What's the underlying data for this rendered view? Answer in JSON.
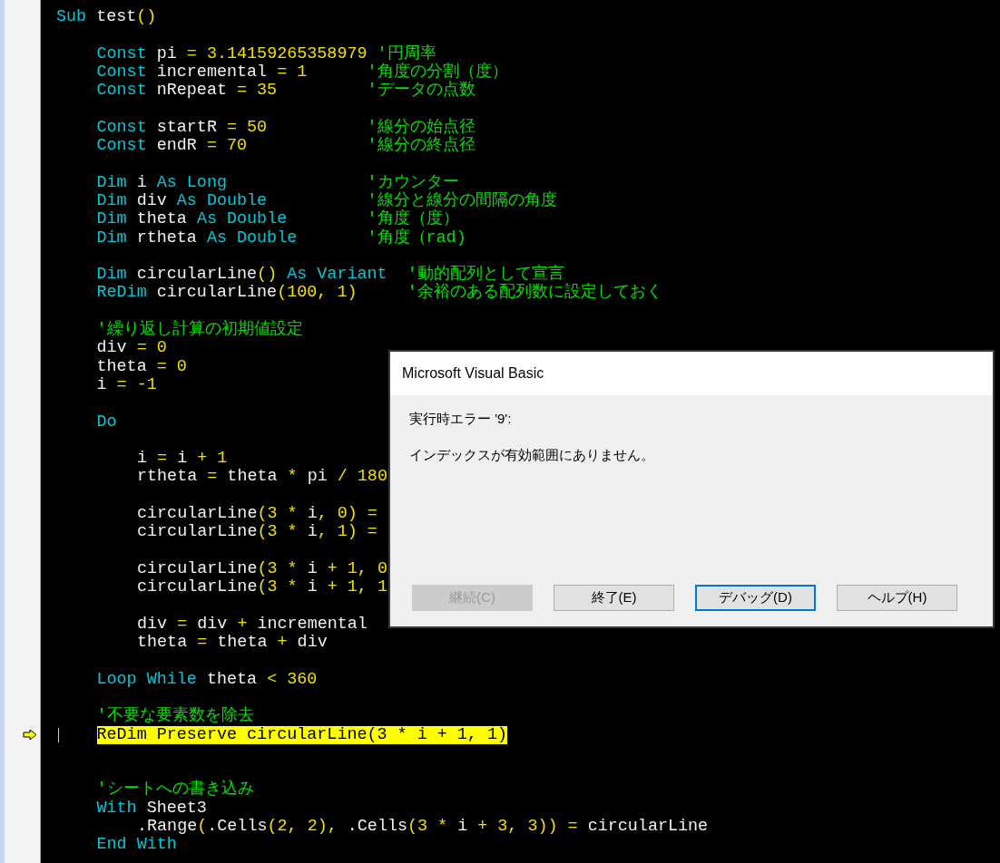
{
  "code": [
    {
      "blank_after": true,
      "tokens": [
        {
          "kind": "keyword",
          "text": "Sub"
        },
        {
          "kind": "identifier",
          "text": " test"
        },
        {
          "kind": "operator",
          "text": "()"
        }
      ],
      "children": [
        {
          "tokens": [
            {
              "kind": "keyword",
              "text": "Const"
            },
            {
              "kind": "identifier",
              "text": " pi "
            },
            {
              "kind": "operator",
              "text": "= 3.14159265358979 "
            },
            {
              "kind": "comment",
              "text": "'円周率"
            }
          ]
        },
        {
          "tokens": [
            {
              "kind": "keyword",
              "text": "Const"
            },
            {
              "kind": "identifier",
              "text": " incremental "
            },
            {
              "kind": "operator",
              "text": "= 1      "
            },
            {
              "kind": "comment",
              "text": "'角度の分割（度）"
            }
          ]
        },
        {
          "blank_after": true,
          "tokens": [
            {
              "kind": "keyword",
              "text": "Const"
            },
            {
              "kind": "identifier",
              "text": " nRepeat "
            },
            {
              "kind": "operator",
              "text": "= 35         "
            },
            {
              "kind": "comment",
              "text": "'データの点数"
            }
          ]
        },
        {
          "tokens": [
            {
              "kind": "keyword",
              "text": "Const"
            },
            {
              "kind": "identifier",
              "text": " startR "
            },
            {
              "kind": "operator",
              "text": "= 50          "
            },
            {
              "kind": "comment",
              "text": "'線分の始点径"
            }
          ]
        },
        {
          "blank_after": true,
          "tokens": [
            {
              "kind": "keyword",
              "text": "Const"
            },
            {
              "kind": "identifier",
              "text": " endR "
            },
            {
              "kind": "operator",
              "text": "= 70            "
            },
            {
              "kind": "comment",
              "text": "'線分の終点径"
            }
          ]
        },
        {
          "tokens": [
            {
              "kind": "keyword",
              "text": "Dim"
            },
            {
              "kind": "identifier",
              "text": " i "
            },
            {
              "kind": "keyword",
              "text": "As Long              "
            },
            {
              "kind": "comment",
              "text": "'カウンター"
            }
          ]
        },
        {
          "tokens": [
            {
              "kind": "keyword",
              "text": "Dim"
            },
            {
              "kind": "identifier",
              "text": " div "
            },
            {
              "kind": "keyword",
              "text": "As Double          "
            },
            {
              "kind": "comment",
              "text": "'線分と線分の間隔の角度"
            }
          ]
        },
        {
          "tokens": [
            {
              "kind": "keyword",
              "text": "Dim"
            },
            {
              "kind": "identifier",
              "text": " theta "
            },
            {
              "kind": "keyword",
              "text": "As Double        "
            },
            {
              "kind": "comment",
              "text": "'角度（度）"
            }
          ]
        },
        {
          "blank_after": true,
          "tokens": [
            {
              "kind": "keyword",
              "text": "Dim"
            },
            {
              "kind": "identifier",
              "text": " rtheta "
            },
            {
              "kind": "keyword",
              "text": "As Double       "
            },
            {
              "kind": "comment",
              "text": "'角度（rad)"
            }
          ]
        },
        {
          "tokens": [
            {
              "kind": "keyword",
              "text": "Dim"
            },
            {
              "kind": "identifier",
              "text": " circularLine"
            },
            {
              "kind": "operator",
              "text": "() "
            },
            {
              "kind": "keyword",
              "text": "As Variant  "
            },
            {
              "kind": "comment",
              "text": "'動的配列として宣言"
            }
          ]
        },
        {
          "blank_after": true,
          "tokens": [
            {
              "kind": "keyword",
              "text": "ReDim"
            },
            {
              "kind": "identifier",
              "text": " circularLine"
            },
            {
              "kind": "operator",
              "text": "(100, 1)     "
            },
            {
              "kind": "comment",
              "text": "'余裕のある配列数に設定しておく"
            }
          ]
        },
        {
          "tokens": [
            {
              "kind": "comment",
              "text": "'繰り返し計算の初期値設定"
            }
          ]
        },
        {
          "tokens": [
            {
              "kind": "identifier",
              "text": "div "
            },
            {
              "kind": "operator",
              "text": "= 0"
            }
          ]
        },
        {
          "tokens": [
            {
              "kind": "identifier",
              "text": "theta "
            },
            {
              "kind": "operator",
              "text": "= 0"
            }
          ]
        },
        {
          "blank_after": true,
          "tokens": [
            {
              "kind": "identifier",
              "text": "i "
            },
            {
              "kind": "operator",
              "text": "= -1"
            }
          ]
        },
        {
          "blank_after": true,
          "tokens": [
            {
              "kind": "keyword",
              "text": "Do"
            }
          ],
          "children": [
            {
              "tokens": [
                {
                  "kind": "identifier",
                  "text": "i "
                },
                {
                  "kind": "operator",
                  "text": "= "
                },
                {
                  "kind": "identifier",
                  "text": "i "
                },
                {
                  "kind": "operator",
                  "text": "+ 1"
                }
              ]
            },
            {
              "blank_after": true,
              "tokens": [
                {
                  "kind": "identifier",
                  "text": "rtheta "
                },
                {
                  "kind": "operator",
                  "text": "= "
                },
                {
                  "kind": "identifier",
                  "text": "theta "
                },
                {
                  "kind": "operator",
                  "text": "* "
                },
                {
                  "kind": "identifier",
                  "text": "pi "
                },
                {
                  "kind": "operator",
                  "text": "/ 180"
                }
              ]
            },
            {
              "tokens": [
                {
                  "kind": "identifier",
                  "text": "circularLine"
                },
                {
                  "kind": "operator",
                  "text": "(3 * "
                },
                {
                  "kind": "identifier",
                  "text": "i"
                },
                {
                  "kind": "operator",
                  "text": ", 0) ="
                }
              ]
            },
            {
              "blank_after": true,
              "tokens": [
                {
                  "kind": "identifier",
                  "text": "circularLine"
                },
                {
                  "kind": "operator",
                  "text": "(3 * "
                },
                {
                  "kind": "identifier",
                  "text": "i"
                },
                {
                  "kind": "operator",
                  "text": ", 1) ="
                }
              ]
            },
            {
              "tokens": [
                {
                  "kind": "identifier",
                  "text": "circularLine"
                },
                {
                  "kind": "operator",
                  "text": "(3 * "
                },
                {
                  "kind": "identifier",
                  "text": "i "
                },
                {
                  "kind": "operator",
                  "text": "+ 1, 0"
                }
              ]
            },
            {
              "blank_after": true,
              "tokens": [
                {
                  "kind": "identifier",
                  "text": "circularLine"
                },
                {
                  "kind": "operator",
                  "text": "(3 * "
                },
                {
                  "kind": "identifier",
                  "text": "i "
                },
                {
                  "kind": "operator",
                  "text": "+ 1, 1"
                }
              ]
            },
            {
              "tokens": [
                {
                  "kind": "identifier",
                  "text": "div "
                },
                {
                  "kind": "operator",
                  "text": "= "
                },
                {
                  "kind": "identifier",
                  "text": "div "
                },
                {
                  "kind": "operator",
                  "text": "+ "
                },
                {
                  "kind": "identifier",
                  "text": "incremental"
                }
              ]
            },
            {
              "blank_after": true,
              "tokens": [
                {
                  "kind": "identifier",
                  "text": "theta "
                },
                {
                  "kind": "operator",
                  "text": "= "
                },
                {
                  "kind": "identifier",
                  "text": "theta "
                },
                {
                  "kind": "operator",
                  "text": "+ "
                },
                {
                  "kind": "identifier",
                  "text": "div"
                }
              ]
            }
          ]
        },
        {
          "blank_after": true,
          "tokens": [
            {
              "kind": "keyword",
              "text": "Loop While"
            },
            {
              "kind": "identifier",
              "text": " theta "
            },
            {
              "kind": "operator",
              "text": "< 360"
            }
          ]
        },
        {
          "tokens": [
            {
              "kind": "comment",
              "text": "'不要な要素数を除去"
            }
          ]
        },
        {
          "current": true,
          "caret": true,
          "blank_after": true,
          "tokens": [
            {
              "kind": "keyword",
              "text": "ReDim Preserve"
            },
            {
              "kind": "identifier",
              "text": " circularLine"
            },
            {
              "kind": "operator",
              "text": "(3 * "
            },
            {
              "kind": "identifier",
              "text": "i "
            },
            {
              "kind": "operator",
              "text": "+ 1, 1)"
            }
          ]
        },
        {
          "blank_before": true,
          "tokens": [
            {
              "kind": "comment",
              "text": "'シートへの書き込み"
            }
          ]
        },
        {
          "tokens": [
            {
              "kind": "keyword",
              "text": "With"
            },
            {
              "kind": "identifier",
              "text": " Sheet3"
            }
          ],
          "children": [
            {
              "tokens": [
                {
                  "kind": "identifier",
                  "text": ".Range"
                },
                {
                  "kind": "operator",
                  "text": "("
                },
                {
                  "kind": "identifier",
                  "text": ".Cells"
                },
                {
                  "kind": "operator",
                  "text": "(2, 2), "
                },
                {
                  "kind": "identifier",
                  "text": ".Cells"
                },
                {
                  "kind": "operator",
                  "text": "(3 * "
                },
                {
                  "kind": "identifier",
                  "text": "i "
                },
                {
                  "kind": "operator",
                  "text": "+ 3, 3)) = "
                },
                {
                  "kind": "identifier",
                  "text": "circularLine"
                }
              ]
            }
          ]
        },
        {
          "tokens": [
            {
              "kind": "keyword",
              "text": "End With"
            }
          ]
        }
      ]
    }
  ],
  "dialog": {
    "title": "Microsoft Visual Basic",
    "heading": "実行時エラー '9':",
    "message": "インデックスが有効範囲にありません。",
    "buttons": [
      {
        "label": "継続(C)",
        "disabled": true,
        "focused": false
      },
      {
        "label": "終了(E)",
        "disabled": false,
        "focused": false
      },
      {
        "label": "デバッグ(D)",
        "disabled": false,
        "focused": true
      },
      {
        "label": "ヘルプ(H)",
        "disabled": false,
        "focused": false
      }
    ]
  }
}
